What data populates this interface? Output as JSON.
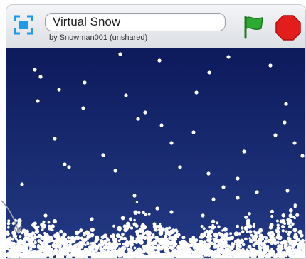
{
  "project": {
    "title": "Virtual Snow",
    "byline": "by Snowman001 (unshared)"
  },
  "icons": {
    "fullscreen": "fullscreen-icon",
    "green_flag": "green-flag-icon",
    "stop": "stop-sign-icon"
  },
  "colors": {
    "stage_background": "#16246b",
    "snow": "#ffffff",
    "flag": "#2eaa33",
    "stop": "#e31c1c",
    "fullscreen": "#1e9be6"
  }
}
